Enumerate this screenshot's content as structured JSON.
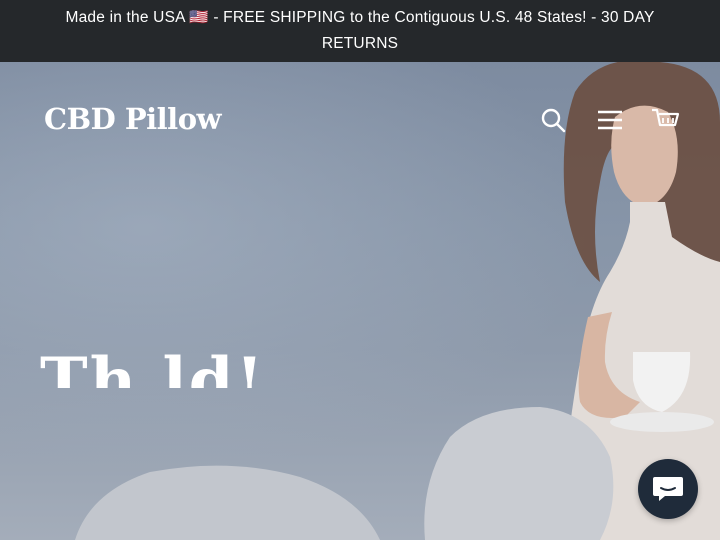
{
  "announcement": {
    "text": "Made in the USA 🇺🇸 - FREE SHIPPING to the Contiguous U.S. 48 States! - 30 DAY RETURNS"
  },
  "header": {
    "logo_text": "CBD Pillow",
    "icons": [
      "search-icon",
      "menu-icon",
      "cart-icon"
    ]
  },
  "hero": {
    "heading_fragment": "Th   ld!   "
  },
  "chat": {
    "icon": "chat-bubble-icon"
  },
  "colors": {
    "announcement_bg": "#25282b",
    "hero_overlay": "#8795a8",
    "chat_bg": "#1f2b3a",
    "text": "#ffffff"
  }
}
